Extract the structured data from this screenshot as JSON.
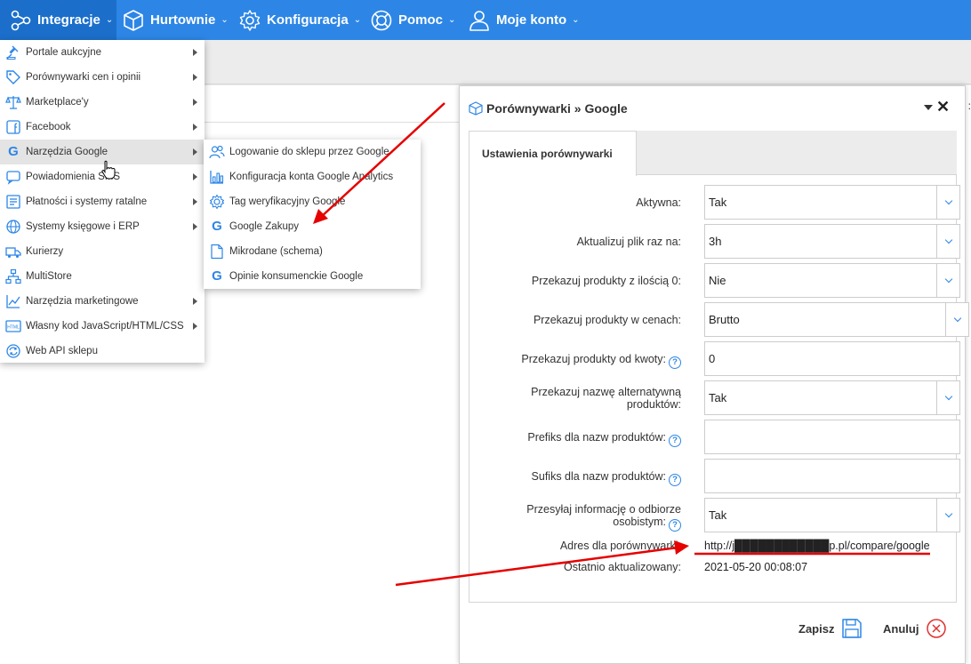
{
  "nav": {
    "items": [
      {
        "label": "Integracje",
        "icon": "share-nodes-icon"
      },
      {
        "label": "Hurtownie",
        "icon": "box-icon"
      },
      {
        "label": "Konfiguracja",
        "icon": "gear-icon"
      },
      {
        "label": "Pomoc",
        "icon": "lifebuoy-icon"
      },
      {
        "label": "Moje konto",
        "icon": "user-icon"
      }
    ]
  },
  "menu": {
    "items": [
      {
        "label": "Portale aukcyjne",
        "icon": "gavel-icon",
        "submenu": true
      },
      {
        "label": "Porównywarki cen i opinii",
        "icon": "tag-icon",
        "submenu": true
      },
      {
        "label": "Marketplace'y",
        "icon": "scales-icon",
        "submenu": true
      },
      {
        "label": "Facebook",
        "icon": "facebook-icon",
        "submenu": true
      },
      {
        "label": "Narzędzia Google",
        "icon": "google-icon",
        "submenu": true
      },
      {
        "label": "Powiadomienia SMS",
        "icon": "sms-icon",
        "submenu": true
      },
      {
        "label": "Płatności i systemy ratalne",
        "icon": "payment-icon",
        "submenu": true
      },
      {
        "label": "Systemy księgowe i ERP",
        "icon": "globe-icon",
        "submenu": true
      },
      {
        "label": "Kurierzy",
        "icon": "truck-icon",
        "submenu": false
      },
      {
        "label": "MultiStore",
        "icon": "sitemap-icon",
        "submenu": false
      },
      {
        "label": "Narzędzia marketingowe",
        "icon": "chart-icon",
        "submenu": true
      },
      {
        "label": "Własny kod JavaScript/HTML/CSS",
        "icon": "html-icon",
        "submenu": true
      },
      {
        "label": "Web API sklepu",
        "icon": "sync-icon",
        "submenu": false
      }
    ]
  },
  "submenu": {
    "items": [
      {
        "label": "Logowanie do sklepu przez Google",
        "icon": "users-icon"
      },
      {
        "label": "Konfiguracja konta Google Analytics",
        "icon": "bar-chart-icon"
      },
      {
        "label": "Tag weryfikacyjny Google",
        "icon": "gear-icon"
      },
      {
        "label": "Google Zakupy",
        "icon": "google-icon"
      },
      {
        "label": "Mikrodane (schema)",
        "icon": "document-icon"
      },
      {
        "label": "Opinie konsumenckie Google",
        "icon": "google-icon"
      }
    ]
  },
  "dialog": {
    "title": "Porównywarki » Google",
    "tab": "Ustawienia porównywarki",
    "fields": {
      "aktywna": {
        "label": "Aktywna:",
        "value": "Tak"
      },
      "aktualizuj": {
        "label": "Aktualizuj plik raz na:",
        "value": "3h"
      },
      "zero": {
        "label": "Przekazuj produkty z ilością 0:",
        "value": "Nie"
      },
      "ceny": {
        "label": "Przekazuj produkty w cenach:",
        "value": "Brutto"
      },
      "kwota": {
        "label": "Przekazuj produkty od kwoty:",
        "value": "0"
      },
      "alt_line1": "Przekazuj nazwę alternatywną",
      "alt_line2": "produktów:",
      "alt_value": "Tak",
      "prefiks": {
        "label": "Prefiks dla nazw produktów:",
        "value": ""
      },
      "sufiks": {
        "label": "Sufiks dla nazw produktów:",
        "value": ""
      },
      "odbior_line1": "Przesyłaj informację o odbiorze",
      "odbior_line2": "osobistym:",
      "odbior_value": "Tak",
      "adres": {
        "label": "Adres dla porównywarki:",
        "value": "http://j████████████p.pl/compare/google"
      },
      "aktualizowany": {
        "label": "Ostatnio aktualizowany:",
        "value": "2021-05-20 00:08:07"
      }
    },
    "help_glyph": "?",
    "save_label": "Zapisz",
    "cancel_label": "Anuluj"
  },
  "colors": {
    "accent": "#2d86e6",
    "annotation": "#e60000"
  }
}
